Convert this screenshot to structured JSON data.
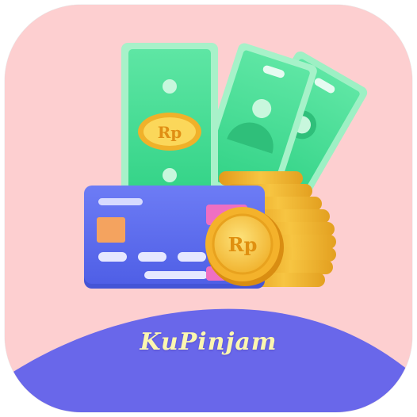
{
  "app": {
    "name": "KuPinjam",
    "currency_symbol": "Rp"
  },
  "colors": {
    "background": "#fdcfd0",
    "wave": "#6967ea",
    "banknote": "#3edb8e",
    "card": "#5a6bf0",
    "coin": "#f2b52a",
    "title_text": "#fbf6b0"
  },
  "icons": [
    "banknote-icon",
    "credit-card-icon",
    "gold-coin-icon",
    "coin-stack-icon"
  ]
}
